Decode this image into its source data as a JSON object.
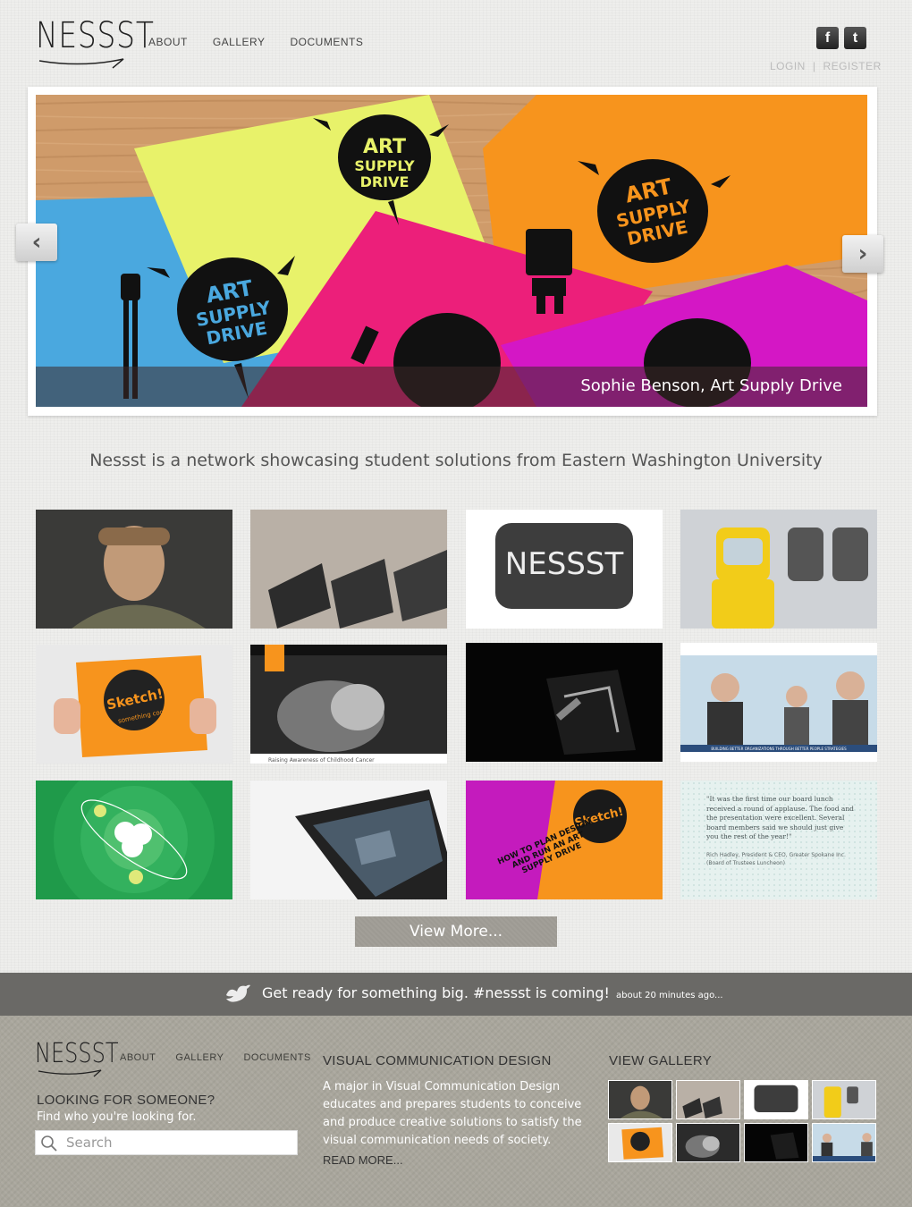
{
  "header": {
    "logo_text": "NESSST",
    "nav": [
      "ABOUT",
      "GALLERY",
      "DOCUMENTS"
    ],
    "social": [
      {
        "icon": "facebook-icon",
        "glyph": "f"
      },
      {
        "icon": "twitter-icon",
        "glyph": "t"
      }
    ],
    "login_label": "LOGIN",
    "separator": "|",
    "register_label": "REGISTER"
  },
  "slider": {
    "caption": "Sophie Benson, Art Supply Drive",
    "poster_text_line1": "ART",
    "poster_text_line2": "SUPPLY",
    "poster_text_line3": "DRIVE",
    "prev_glyph": "‹",
    "next_glyph": "›"
  },
  "tagline": "Nessst is a network showcasing student solutions from Eastern Washington University",
  "gallery": {
    "items": [
      {
        "label": "portrait"
      },
      {
        "label": "dumbbells"
      },
      {
        "label": "nessst-logo",
        "text": "NESSST"
      },
      {
        "label": "lego-hazmat"
      },
      {
        "label": "sketch-poster",
        "text": "Sketch!",
        "sub": "something cool."
      },
      {
        "label": "childhood-cancer-site",
        "text": "Raising Awareness of Childhood Cancer"
      },
      {
        "label": "dark-film"
      },
      {
        "label": "corporate-site",
        "text": "BUILDING BETTER ORGANIZATIONS THROUGH BETTER PEOPLE STRATEGIES"
      },
      {
        "label": "atom-illustration"
      },
      {
        "label": "iphone"
      },
      {
        "label": "plan-design-booklet",
        "text": "HOW TO PLAN DESIGN AND RUN AN ART SUPPLY DRIVE",
        "sub": "Sketch!"
      },
      {
        "label": "testimonial",
        "text": "\"It was the first time our board lunch received a round of applause. The food and the presentation were excellent. Several board members said we should just give you the rest of the year!\"",
        "sub": "Rich Hadley, President & CEO, Greater Spokane Inc. (Board of Trustees Luncheon)"
      }
    ],
    "view_more": "View More..."
  },
  "twitter": {
    "icon": "twitter-bird-icon",
    "text": "Get ready for something big. #nessst is coming!",
    "time": "about 20 minutes ago..."
  },
  "footer": {
    "logo_text": "NESSST",
    "nav": [
      "ABOUT",
      "GALLERY",
      "DOCUMENTS"
    ],
    "search_heading": "LOOKING FOR SOMEONE?",
    "search_sub": "Find who you're looking for.",
    "search_placeholder": "Search",
    "vcd_heading": "VISUAL COMMUNICATION DESIGN",
    "vcd_body": "A major in Visual Communication Design educates and prepares students to conceive and produce creative solutions to satisfy the visual communication needs of society.",
    "read_more": "READ MORE...",
    "gallery_heading": "VIEW GALLERY"
  },
  "colors": {
    "accent_orange": "#f7941d",
    "accent_magenta": "#e0119a",
    "accent_blue": "#4aa8df",
    "accent_yellow": "#e8f26a",
    "footer_bg": "#a9a69c",
    "tweet_bar": "#6a6966"
  }
}
